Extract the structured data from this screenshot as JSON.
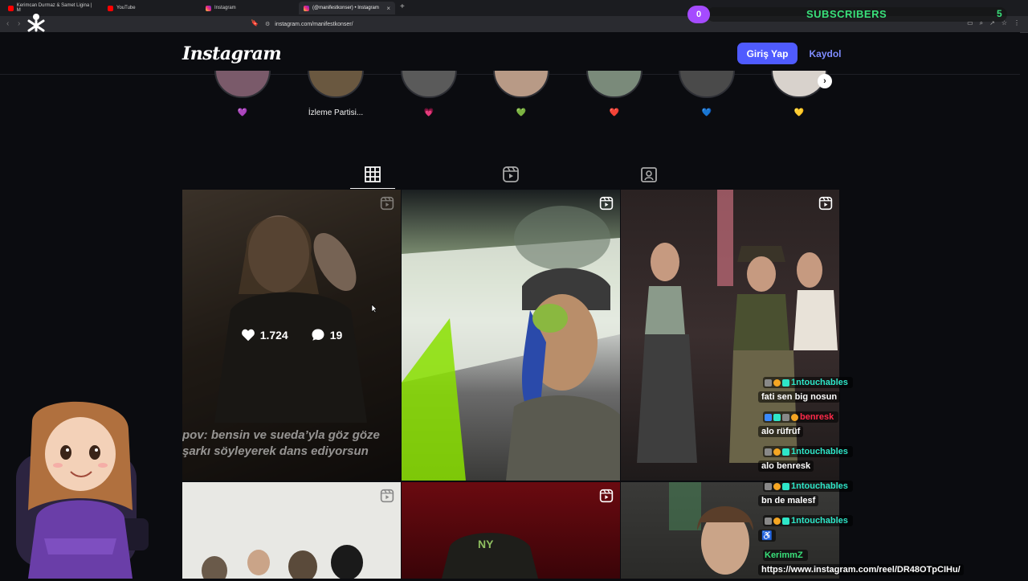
{
  "browser": {
    "tabs": [
      {
        "label": "Kerimcan Durmaz & Samet Ligina | M",
        "favicon": "youtube-icon",
        "active": false
      },
      {
        "label": "YouTube",
        "favicon": "youtube-icon",
        "active": false
      },
      {
        "label": "Instagram",
        "favicon": "instagram-icon",
        "active": false
      },
      {
        "label": "(@manifestkonser) • Instagram",
        "favicon": "instagram-icon",
        "active": true
      }
    ],
    "url": "instagram.com/manifestkonser/"
  },
  "header": {
    "logo": "Instagram",
    "login_label": "Giriş Yap",
    "signup_label": "Kaydol"
  },
  "highlights": [
    {
      "label": "💜",
      "ring_color": "#7a5a6a"
    },
    {
      "label": "İzleme Partisi...",
      "ring_color": "#6a5840"
    },
    {
      "label": "💗",
      "ring_color": "#5a5a5a"
    },
    {
      "label": "💚",
      "ring_color": "#b89a86"
    },
    {
      "label": "❤️",
      "ring_color": "#7a8a7a"
    },
    {
      "label": "💙",
      "ring_color": "#4a4a4a"
    },
    {
      "label": "💛",
      "ring_color": "#d8d2cc"
    }
  ],
  "profile_tabs": [
    "posts-grid-icon",
    "reels-icon",
    "tagged-icon"
  ],
  "posts": [
    {
      "likes": "1.724",
      "comments": "19",
      "caption_line1": "pov: bensin ve sueda’yla göz göze",
      "caption_line2": "şarkı söyleyerek dans ediyorsun",
      "hovered": true,
      "bg": "#4a4036"
    },
    {
      "bg": "#3a4a3a",
      "hovered": false
    },
    {
      "bg": "#2a2626",
      "hovered": false
    },
    {
      "bg": "#e8e8e4",
      "hovered": false
    },
    {
      "bg": "#5a0a0e",
      "hovered": false
    },
    {
      "bg": "#3a3a38",
      "hovered": false
    }
  ],
  "stream_overlay": {
    "subscribers_label": "SUBSCRIBERS",
    "subscriber_count": "0",
    "subscriber_goal": "5"
  },
  "chat": [
    {
      "user": "1ntouchables",
      "user_color": "#2ee6c8",
      "text": "fati sen big nosun"
    },
    {
      "user": "benresk",
      "user_color": "#ff2a4a",
      "text": "alo rüfrüf"
    },
    {
      "user": "1ntouchables",
      "user_color": "#2ee6c8",
      "text": "alo benresk"
    },
    {
      "user": "1ntouchables",
      "user_color": "#2ee6c8",
      "text": "bn de malesf"
    },
    {
      "user": "1ntouchables",
      "user_color": "#2ee6c8",
      "text": "♿"
    },
    {
      "user": "KerimmZ",
      "user_color": "#39e07a",
      "text": "https://www.instagram.com/reel/DR48OTpCIHu/"
    }
  ]
}
